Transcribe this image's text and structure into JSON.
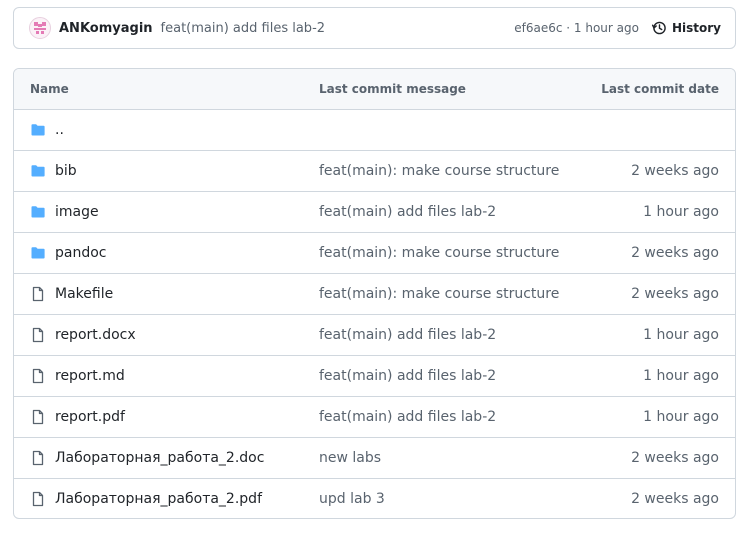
{
  "commit": {
    "author": "ANKomyagin",
    "message": "feat(main) add files lab-2",
    "sha_time": "ef6ae6c · 1 hour ago",
    "history_label": "History",
    "history_icon": "history-icon",
    "avatar_icon": "identicon-avatar"
  },
  "table": {
    "headers": {
      "name": "Name",
      "message": "Last commit message",
      "date": "Last commit date"
    },
    "rows": [
      {
        "type": "parent",
        "name": "..",
        "message": "",
        "date": ""
      },
      {
        "type": "folder",
        "name": "bib",
        "message": "feat(main): make course structure",
        "date": "2 weeks ago"
      },
      {
        "type": "folder",
        "name": "image",
        "message": "feat(main) add files lab-2",
        "date": "1 hour ago"
      },
      {
        "type": "folder",
        "name": "pandoc",
        "message": "feat(main): make course structure",
        "date": "2 weeks ago"
      },
      {
        "type": "file",
        "name": "Makefile",
        "message": "feat(main): make course structure",
        "date": "2 weeks ago"
      },
      {
        "type": "file",
        "name": "report.docx",
        "message": "feat(main) add files lab-2",
        "date": "1 hour ago"
      },
      {
        "type": "file",
        "name": "report.md",
        "message": "feat(main) add files lab-2",
        "date": "1 hour ago"
      },
      {
        "type": "file",
        "name": "report.pdf",
        "message": "feat(main) add files lab-2",
        "date": "1 hour ago"
      },
      {
        "type": "file",
        "name": "Лабораторная_работа_2.doc",
        "message": "new labs",
        "date": "2 weeks ago"
      },
      {
        "type": "file",
        "name": "Лабораторная_работа_2.pdf",
        "message": "upd lab 3",
        "date": "2 weeks ago"
      }
    ]
  },
  "colors": {
    "folder": "#54aeff",
    "file_icon": "#59636e",
    "border": "#d0d7de",
    "header_bg": "#f6f8fa",
    "muted_text": "#59636e"
  }
}
